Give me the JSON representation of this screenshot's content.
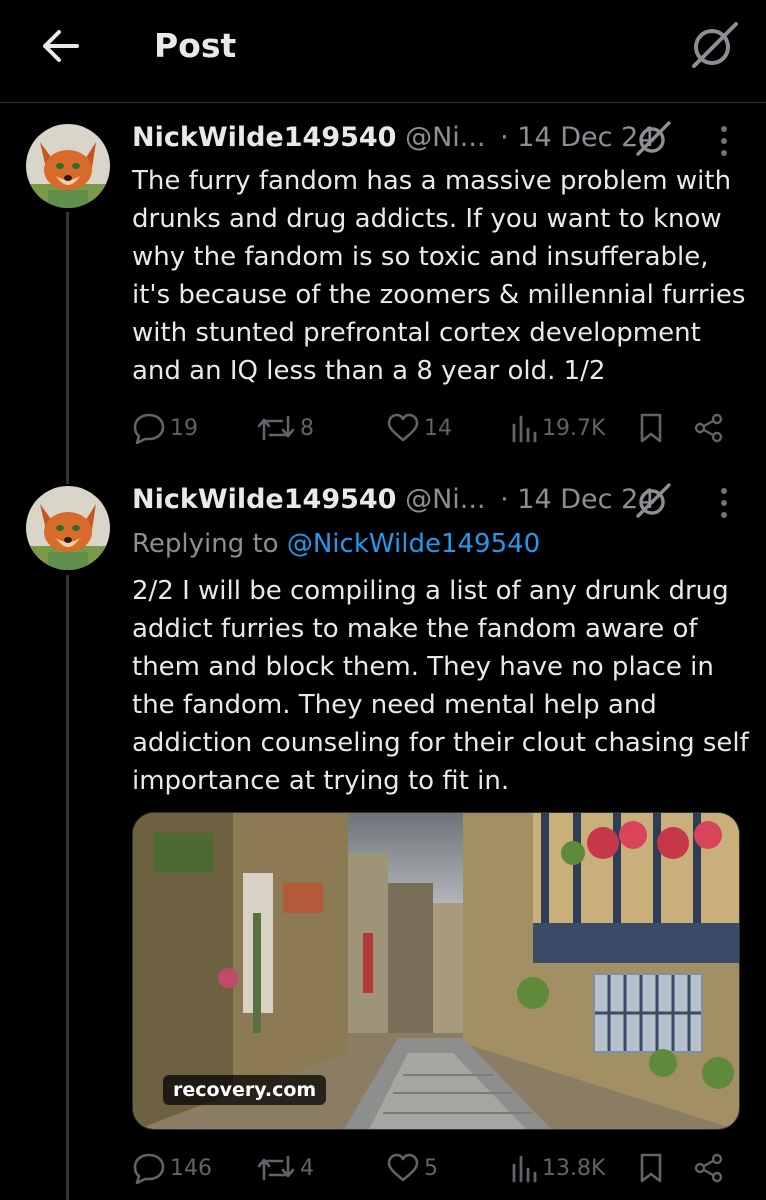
{
  "header": {
    "title": "Post",
    "back_icon": "arrow-left-icon",
    "grok_icon": "grok-icon"
  },
  "tweets": [
    {
      "author_name": "NickWilde149540",
      "author_handle": "@Ni...",
      "separator": "·",
      "date": "14 Dec 24",
      "text": "The furry fandom has a massive problem with drunks and drug addicts. If you want to know why the fandom is so toxic and insufferable, it's because of the zoomers & millennial furries with stunted prefrontal cortex development and an IQ less than a 8 year old. 1/2",
      "stats": {
        "replies": "19",
        "reposts": "8",
        "likes": "14",
        "views": "19.7K"
      }
    },
    {
      "author_name": "NickWilde149540",
      "author_handle": "@Ni...",
      "separator": "·",
      "date": "14 Dec 24",
      "replying_prefix": "Replying to",
      "replying_to": "@NickWilde149540",
      "text": "2/2 I will be compiling a list of any drunk drug addict furries to make the fandom aware of them and block them. They have no place in the fandom. They need mental help and addiction counseling for their clout chasing self importance at trying to fit in.",
      "media_label": "recovery.com",
      "stats": {
        "replies": "146",
        "reposts": "4",
        "likes": "5",
        "views": "13.8K"
      }
    }
  ],
  "colors": {
    "background": "#000000",
    "text": "#e7e9ea",
    "muted": "#8b8f94",
    "link": "#1d9bf0",
    "divider": "#2f3336"
  }
}
